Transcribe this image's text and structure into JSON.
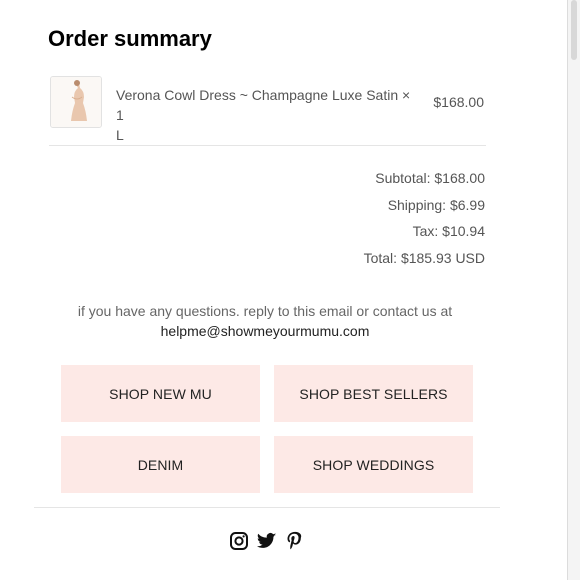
{
  "summary": {
    "title": "Order summary"
  },
  "item": {
    "name_line1": "Verona Cowl Dress ~ Champagne Luxe Satin × 1",
    "name_line2": "L",
    "price": "$168.00"
  },
  "totals": {
    "subtotal": "Subtotal: $168.00",
    "shipping": "Shipping: $6.99",
    "tax": "Tax: $10.94",
    "total": "Total: $185.93 USD"
  },
  "contact": {
    "line1": "if you have any questions. reply to this email or contact us at",
    "email": "helpme@showmeyourmumu.com"
  },
  "buttons": {
    "shop_new": "SHOP NEW MU",
    "best_sellers": "SHOP BEST SELLERS",
    "denim": "DENIM",
    "weddings": "SHOP WEDDINGS"
  },
  "social": {
    "icons": [
      "instagram-icon",
      "twitter-icon",
      "pinterest-icon"
    ]
  },
  "colors": {
    "button_bg": "#fde9e6",
    "title": "#000000",
    "text": "#555555"
  }
}
